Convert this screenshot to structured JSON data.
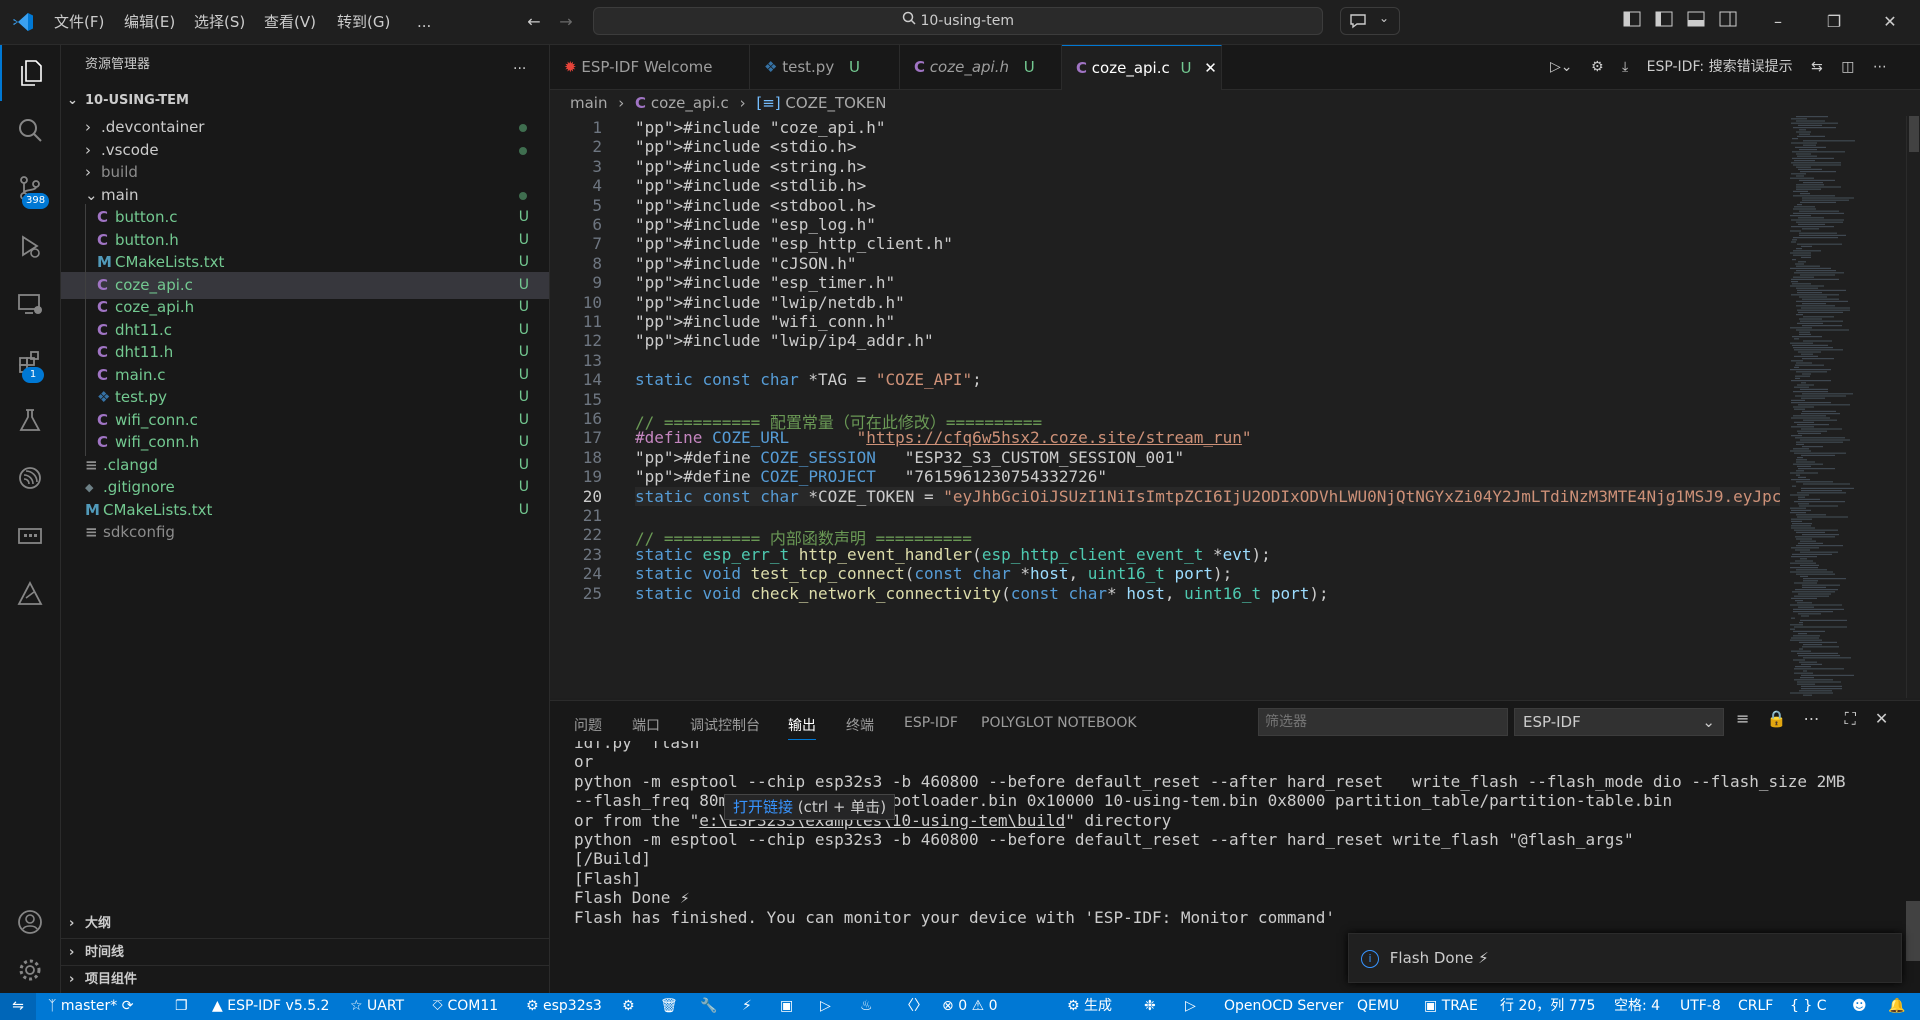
{
  "titlebar": {
    "menus": [
      "文件(F)",
      "编辑(E)",
      "选择(S)",
      "查看(V)",
      "转到(G)",
      "..."
    ],
    "search_text": "10-using-tem"
  },
  "activity": {
    "scm_badge": "398",
    "ext_badge": "1"
  },
  "sidebar": {
    "title": "资源管理器",
    "more": "...",
    "root": "10-USING-TEM",
    "items": [
      {
        "label": ".devcontainer",
        "type": "folder",
        "status": ""
      },
      {
        "label": ".vscode",
        "type": "folder",
        "status": ""
      },
      {
        "label": "build",
        "type": "folder",
        "status": ""
      },
      {
        "label": "main",
        "type": "folder-open",
        "status": ""
      },
      {
        "label": "button.c",
        "type": "c",
        "status": "U"
      },
      {
        "label": "button.h",
        "type": "c",
        "status": "U"
      },
      {
        "label": "CMakeLists.txt",
        "type": "m",
        "status": "U"
      },
      {
        "label": "coze_api.c",
        "type": "c",
        "status": "U"
      },
      {
        "label": "coze_api.h",
        "type": "c",
        "status": "U"
      },
      {
        "label": "dht11.c",
        "type": "c",
        "status": "U"
      },
      {
        "label": "dht11.h",
        "type": "c",
        "status": "U"
      },
      {
        "label": "main.c",
        "type": "c",
        "status": "U"
      },
      {
        "label": "test.py",
        "type": "py",
        "status": "U"
      },
      {
        "label": "wifi_conn.c",
        "type": "c",
        "status": "U"
      },
      {
        "label": "wifi_conn.h",
        "type": "c",
        "status": "U"
      },
      {
        "label": ".clangd",
        "type": "lines",
        "status": "U"
      },
      {
        "label": ".gitignore",
        "type": "git",
        "status": "U"
      },
      {
        "label": "CMakeLists.txt",
        "type": "m",
        "status": "U"
      },
      {
        "label": "sdkconfig",
        "type": "lines",
        "status": ""
      }
    ],
    "sections": [
      "大纲",
      "时间线",
      "项目组件"
    ]
  },
  "tabs": [
    {
      "label": "ESP-IDF Welcome",
      "status": ""
    },
    {
      "label": "test.py",
      "status": "U"
    },
    {
      "label": "coze_api.h",
      "status": "U"
    },
    {
      "label": "coze_api.c",
      "status": "U"
    }
  ],
  "editor_actions": {
    "label": "ESP-IDF:  搜索错误提示"
  },
  "breadcrumb": [
    "main",
    "coze_api.c",
    "COZE_TOKEN"
  ],
  "code_lines": [
    "#include \"coze_api.h\"",
    "#include <stdio.h>",
    "#include <string.h>",
    "#include <stdlib.h>",
    "#include <stdbool.h>",
    "#include \"esp_log.h\"",
    "#include \"esp_http_client.h\"",
    "#include \"cJSON.h\"",
    "#include \"esp_timer.h\"",
    "#include \"lwip/netdb.h\"",
    "#include \"wifi_conn.h\"",
    "#include \"lwip/ip4_addr.h\"",
    "",
    "static const char *TAG = \"COZE_API\";",
    "",
    "// ========== 配置常量（可在此修改）==========",
    "#define COZE_URL       \"https://cfq6w5hsx2.coze.site/stream_run\"",
    "#define COZE_SESSION   \"ESP32_S3_CUSTOM_SESSION_001\"",
    "#define COZE_PROJECT   \"7615961230754332726\"",
    "static const char *COZE_TOKEN = \"eyJhbGciOiJSUzI1NiIsImtpZCI6IjU2ODIxODVhLWU0NjQtNGYxZi04Y2JmLTdiNzM3MTE4Njg1MSJ9.eyJpc",
    "",
    "// ========== 内部函数声明 ==========",
    "static esp_err_t http_event_handler(esp_http_client_event_t *evt);",
    "static void test_tcp_connect(const char *host, uint16_t port);",
    "static void check_network_connectivity(const char* host, uint16_t port);"
  ],
  "panel": {
    "tabs": [
      "问题",
      "端口",
      "调试控制台",
      "输出",
      "终端",
      "ESP-IDF",
      "POLYGLOT NOTEBOOK"
    ],
    "filter_placeholder": "筛选器",
    "channel": "ESP-IDF",
    "output": [
      "idf.py  flash",
      "or",
      "python -m esptool --chip esp32s3 -b 460800 --before default_reset --after hard_reset   write_flash --flash_mode dio --flash_size 2MB",
      "--flash_freq 80m 0x0 bootloader/bootloader.bin 0x10000 10-using-tem.bin 0x8000 partition_table/partition-table.bin",
      "or from the \"e:\\ESP32S3\\examples\\10-using-tem\\build\" directory",
      "python -m esptool --chip esp32s3 -b 460800 --before default_reset --after hard_reset write_flash \"@flash_args\"",
      "[/Build]",
      "[Flash]",
      "Flash Done ⚡",
      "Flash has finished. You can monitor your device with 'ESP-IDF: Monitor command'"
    ],
    "tooltip": {
      "link": "打开链接",
      "hint": "(ctrl + 单击)"
    },
    "notification": "Flash Done ⚡"
  },
  "statusbar": {
    "branch": "master*",
    "idf": "ESP-IDF v5.5.2",
    "uart": "UART",
    "port": "COM11",
    "target": "esp32s3",
    "errors": "0",
    "warnings": "0",
    "build": "生成",
    "openocd": "OpenOCD Server",
    "qemu": "QEMU",
    "trae": "TRAE",
    "position": "行 20，列 775",
    "spaces": "空格: 4",
    "encoding": "UTF-8",
    "eol": "CRLF",
    "lang": "{ } C"
  },
  "colors": {
    "accent": "#0078d4",
    "untracked": "#73c991",
    "c_icon": "#a074c4",
    "py_icon": "#3572a5"
  }
}
